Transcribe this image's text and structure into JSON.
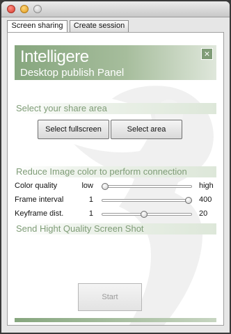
{
  "window": {
    "controls": [
      "close-button",
      "minimize-button",
      "zoom-button"
    ]
  },
  "tabs": [
    {
      "label": "Screen sharing",
      "active": true
    },
    {
      "label": "Create session",
      "active": false
    }
  ],
  "banner": {
    "title": "Intelligere",
    "subtitle": "Desktop publish Panel",
    "close_icon": "×"
  },
  "share_area": {
    "heading": "Select your share area",
    "fullscreen_label": "Select fullscreen",
    "area_label": "Select area"
  },
  "reduce": {
    "heading": "Reduce Image color to perform connection",
    "sliders": [
      {
        "label": "Color quality",
        "min": "low",
        "max": "high",
        "value_fraction": 0.0
      },
      {
        "label": "Frame interval",
        "min": "1",
        "max": "400",
        "value_fraction": 1.0
      },
      {
        "label": "Keyframe dist.",
        "min": "1",
        "max": "20",
        "value_fraction": 0.47
      }
    ]
  },
  "hq": {
    "heading": "Send Hight Quality Screen Shot"
  },
  "start": {
    "label": "Start",
    "enabled": false
  },
  "colors": {
    "accent": "#7f9c77",
    "banner_start": "#86a67e",
    "banner_end": "#dfe7db"
  }
}
